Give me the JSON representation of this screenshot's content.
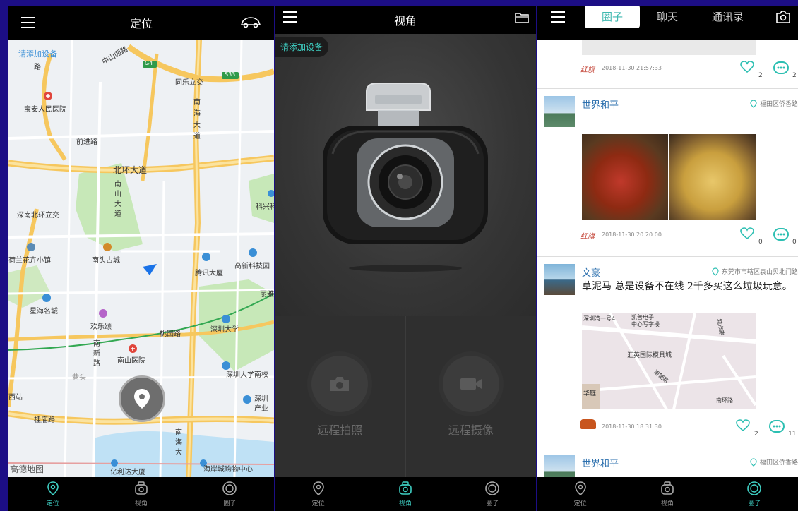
{
  "screen1": {
    "title": "定位",
    "add_device": "请添加设备",
    "map_labels": {
      "zhongshan": "中山园路",
      "lu": "路",
      "g4": "G4",
      "s33": "S33",
      "tongle": "同乐立交",
      "nanhai1": "南",
      "nanhai2": "海",
      "nanhai3": "大",
      "nanhai4": "道",
      "baoan_hospital": "宝安人民医院",
      "qianjin": "前进路",
      "beihuan": "北环大道",
      "nanshan1": "南",
      "nanshan2": "山",
      "nanshan3": "大",
      "nanshan4": "道",
      "shennan_beihuan": "深南北环立交",
      "kexing": "科兴科",
      "lanhua": "荷兰花卉小镇",
      "nantou": "南头古城",
      "gaoxin": "高新科技园",
      "tengxun": "腾讯大厦",
      "xinghai": "星海名城",
      "huanle": "欢乐颂",
      "taoyuan": "桃园路",
      "szu": "深圳大学",
      "lipu": "丽雅",
      "nanxin1": "南",
      "nanxin2": "新",
      "nanxin3": "路",
      "nanshan_hospital": "南山医院",
      "xiangtou": "巷头",
      "szu_south": "深圳大学南校",
      "xizhan": "西站",
      "guimiao": "桂庙路",
      "shenzhen_ind": "深圳",
      "chanye": "产业",
      "gaode": "高德地图",
      "yili": "亿利达大厦",
      "haian": "海岸城购物中心",
      "nanhai_s1": "南",
      "nanhai_s2": "海",
      "nanhai_s3": "大"
    }
  },
  "screen2": {
    "title": "视角",
    "add_device": "请添加设备",
    "remote_photo": "远程拍照",
    "remote_video": "远程摄像"
  },
  "screen3": {
    "segments": [
      "圈子",
      "聊天",
      "通讯录"
    ],
    "posts": [
      {
        "time": "2018-11-30 21:57:33",
        "likes": "2",
        "comments": "2",
        "signature": "红旗"
      },
      {
        "user": "世界和平",
        "location": "福田区侨香路",
        "time": "2018-11-30 20:20:00",
        "likes": "0",
        "comments": "0",
        "signature": "红旗"
      },
      {
        "user": "文豪",
        "location": "东莞市市辖区袁山贝北门路",
        "text": "草泥马 总是设备不在线 2千多买这么垃圾玩意。",
        "time": "2018-11-30 18:31:30",
        "likes": "2",
        "comments": "11",
        "map_labels": [
          "深圳湾一号4",
          "凯普电子",
          "中心写字楼",
          "汇英国际模具城",
          "南铺路",
          "南环路",
          "华庭",
          "城市路"
        ]
      },
      {
        "user": "世界和平",
        "location": "福田区侨香路"
      }
    ]
  },
  "tabs": [
    "定位",
    "视角",
    "圈子"
  ],
  "colors": {
    "accent": "#3fd0c4",
    "background": "#1c0e85"
  }
}
